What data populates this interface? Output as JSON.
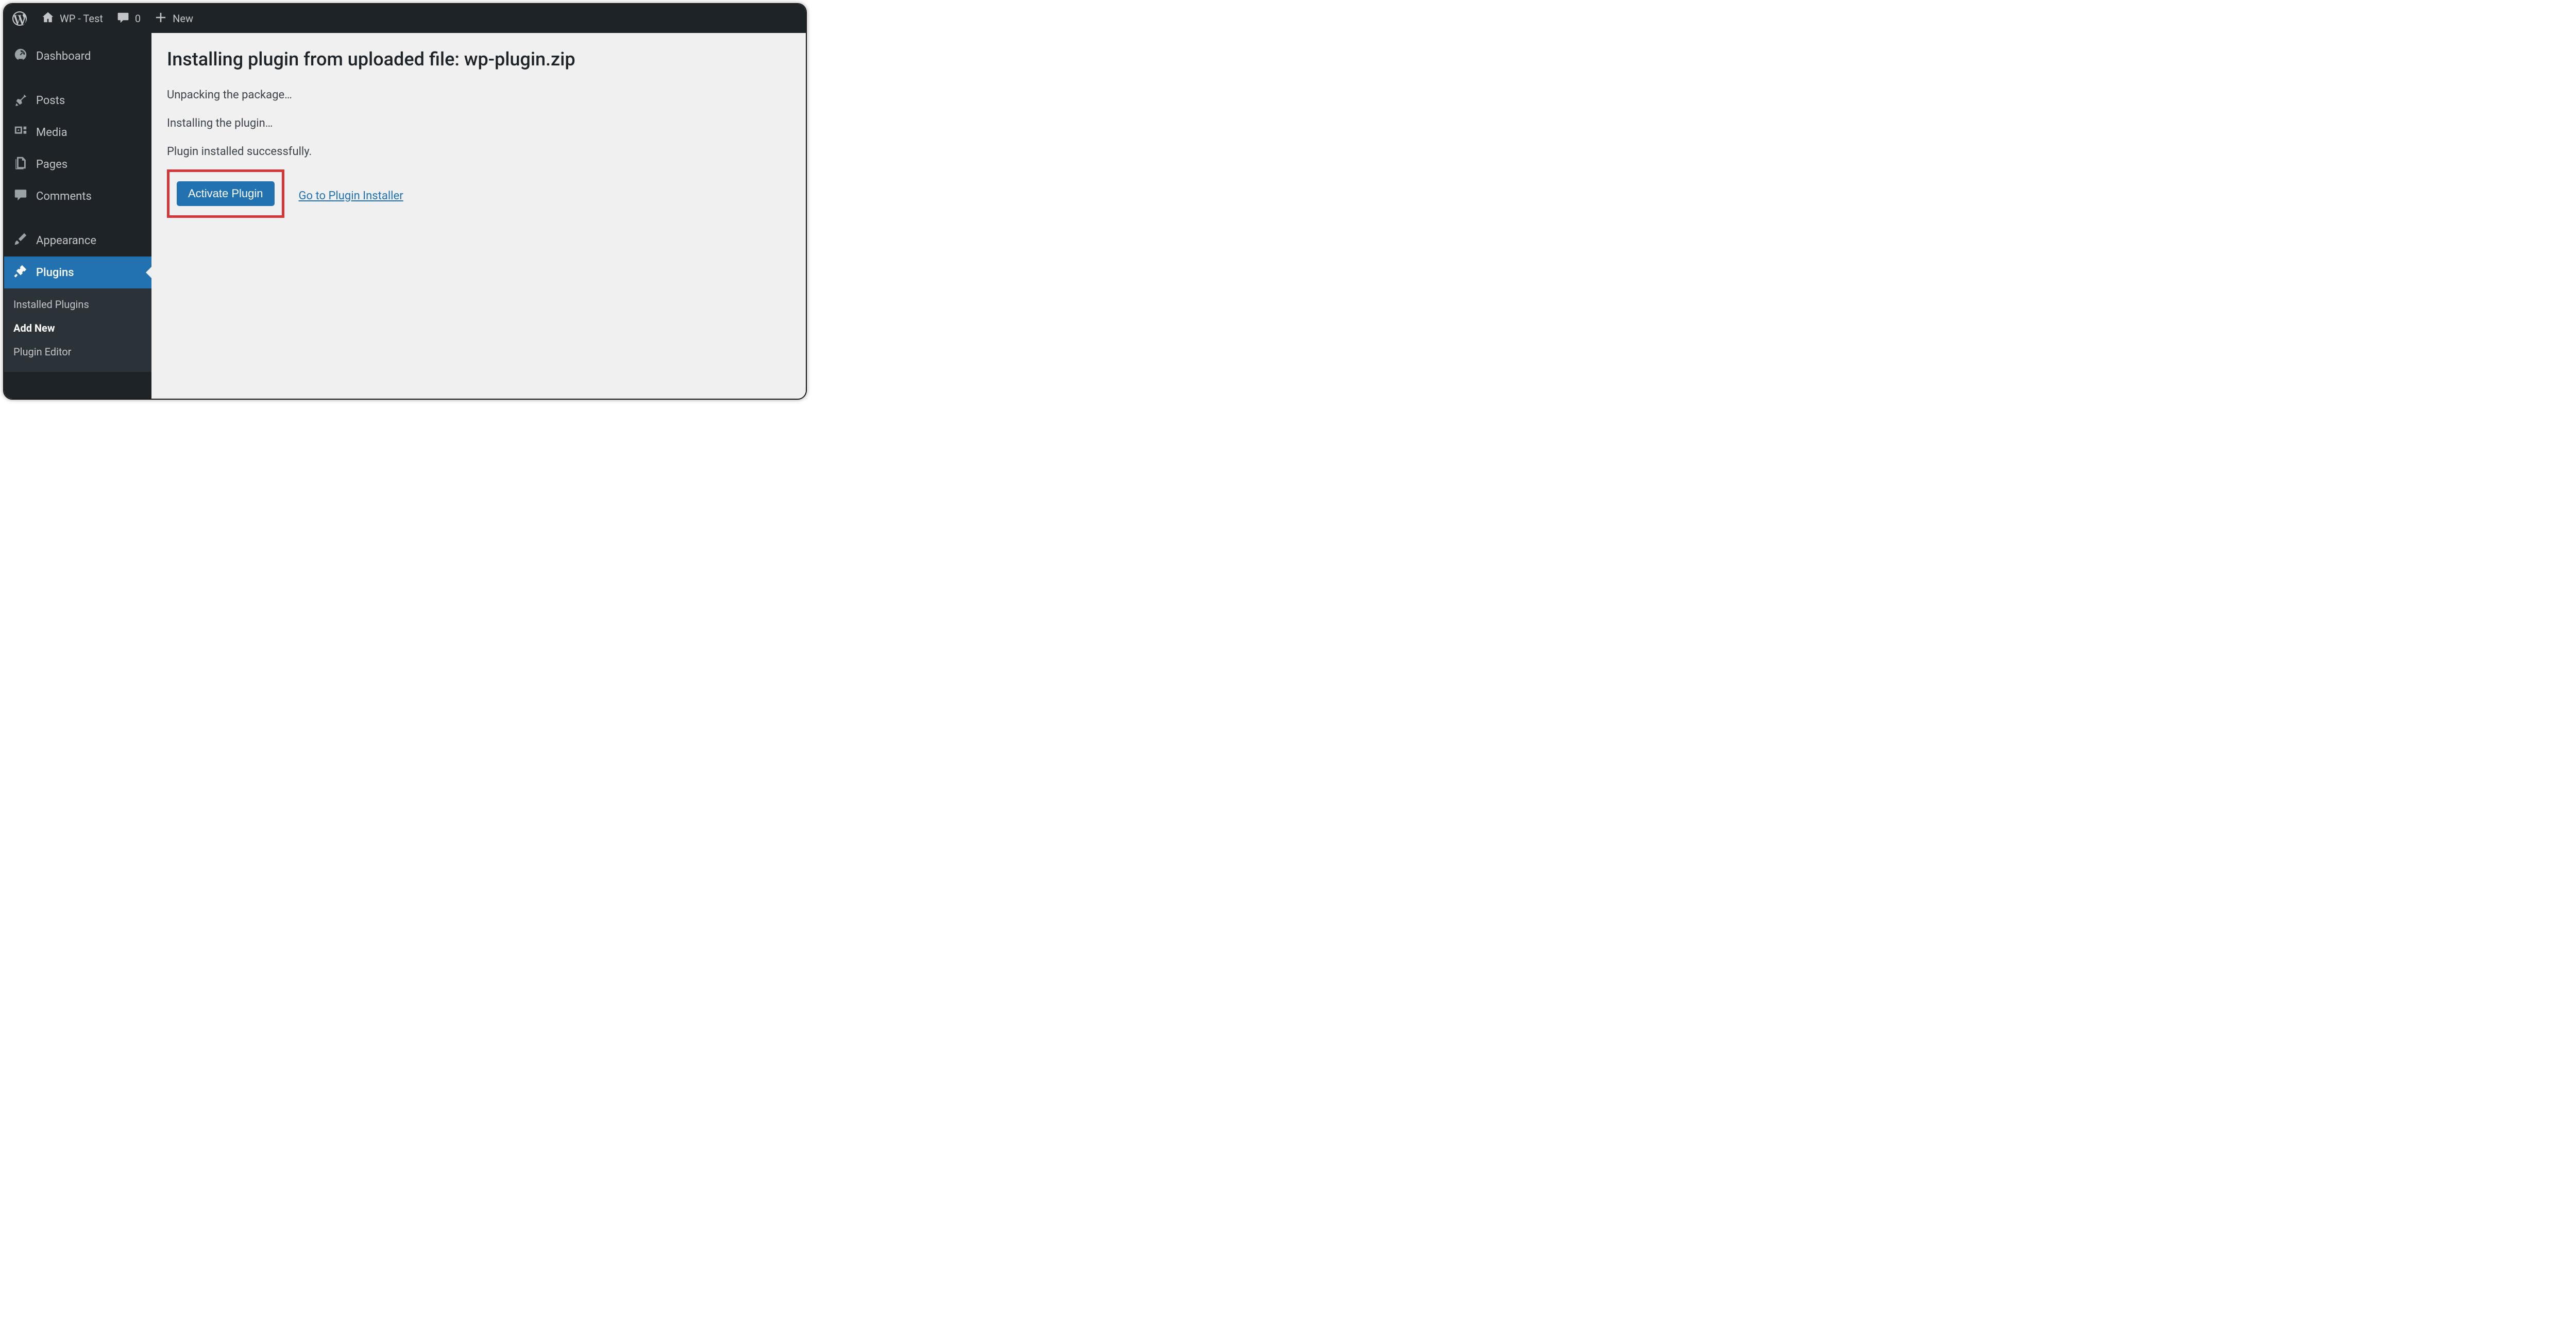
{
  "toolbar": {
    "site_name": "WP - Test",
    "comment_count": "0",
    "new_label": "New"
  },
  "sidebar": {
    "dashboard": "Dashboard",
    "posts": "Posts",
    "media": "Media",
    "pages": "Pages",
    "comments": "Comments",
    "appearance": "Appearance",
    "plugins": "Plugins",
    "submenu": {
      "installed": "Installed Plugins",
      "add_new": "Add New",
      "editor": "Plugin Editor"
    }
  },
  "content": {
    "heading": "Installing plugin from uploaded file: wp-plugin.zip",
    "line1": "Unpacking the package…",
    "line2": "Installing the plugin…",
    "line3": "Plugin installed successfully.",
    "activate_btn": "Activate Plugin",
    "installer_link": "Go to Plugin Installer"
  }
}
